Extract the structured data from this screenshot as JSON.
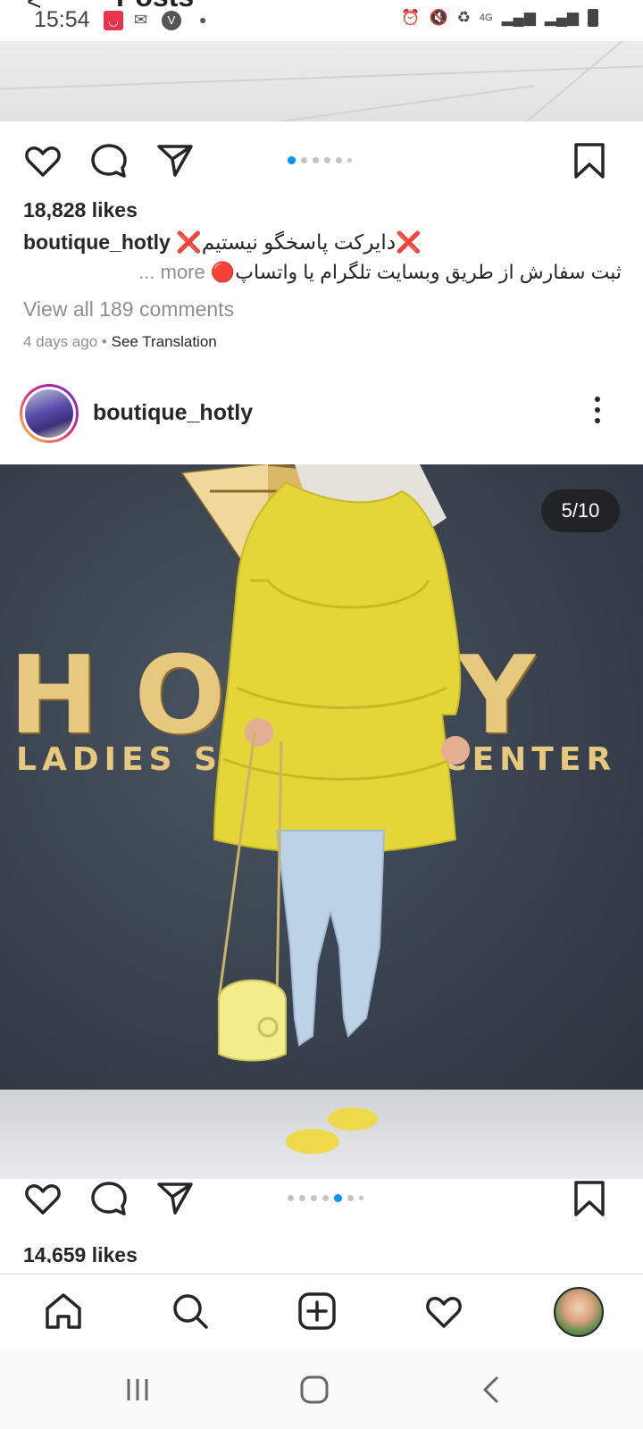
{
  "status_bar": {
    "time": "15:54",
    "header_back": "<",
    "header_title": "Posts",
    "network": "4G",
    "vpn_badge": "V",
    "icons": [
      "notification-badge-icon",
      "message-icon",
      "vpn-icon",
      "alarm-icon",
      "mute-icon",
      "battery-saver-icon",
      "signal-icon",
      "battery-icon"
    ]
  },
  "post1": {
    "likes": "18,828 likes",
    "username": "boutique_hotly",
    "caption_line1": "❌دایرکت پاسخگو نیستیم❌",
    "caption_line2": "🔴ثبت سفارش از طریق وبسایت تلگرام یا واتساپ",
    "more": "... more",
    "view_comments": "View all 189 comments",
    "timestamp": "4 days ago",
    "see_translation": "See Translation",
    "carousel_total": 6,
    "carousel_active": 1
  },
  "post2": {
    "username": "boutique_hotly",
    "counter": "5/10",
    "photo_text_big": "HOTLY",
    "photo_text_small": "LADIES SHOPPING CENTER",
    "likes": "14,659 likes",
    "carousel_total": 7,
    "carousel_active": 5
  },
  "colors": {
    "accent": "#0095f6",
    "text": "#262626",
    "muted": "#8e8e8e"
  },
  "bottom_nav": [
    "home-icon",
    "search-icon",
    "create-icon",
    "activity-icon",
    "profile-avatar"
  ]
}
